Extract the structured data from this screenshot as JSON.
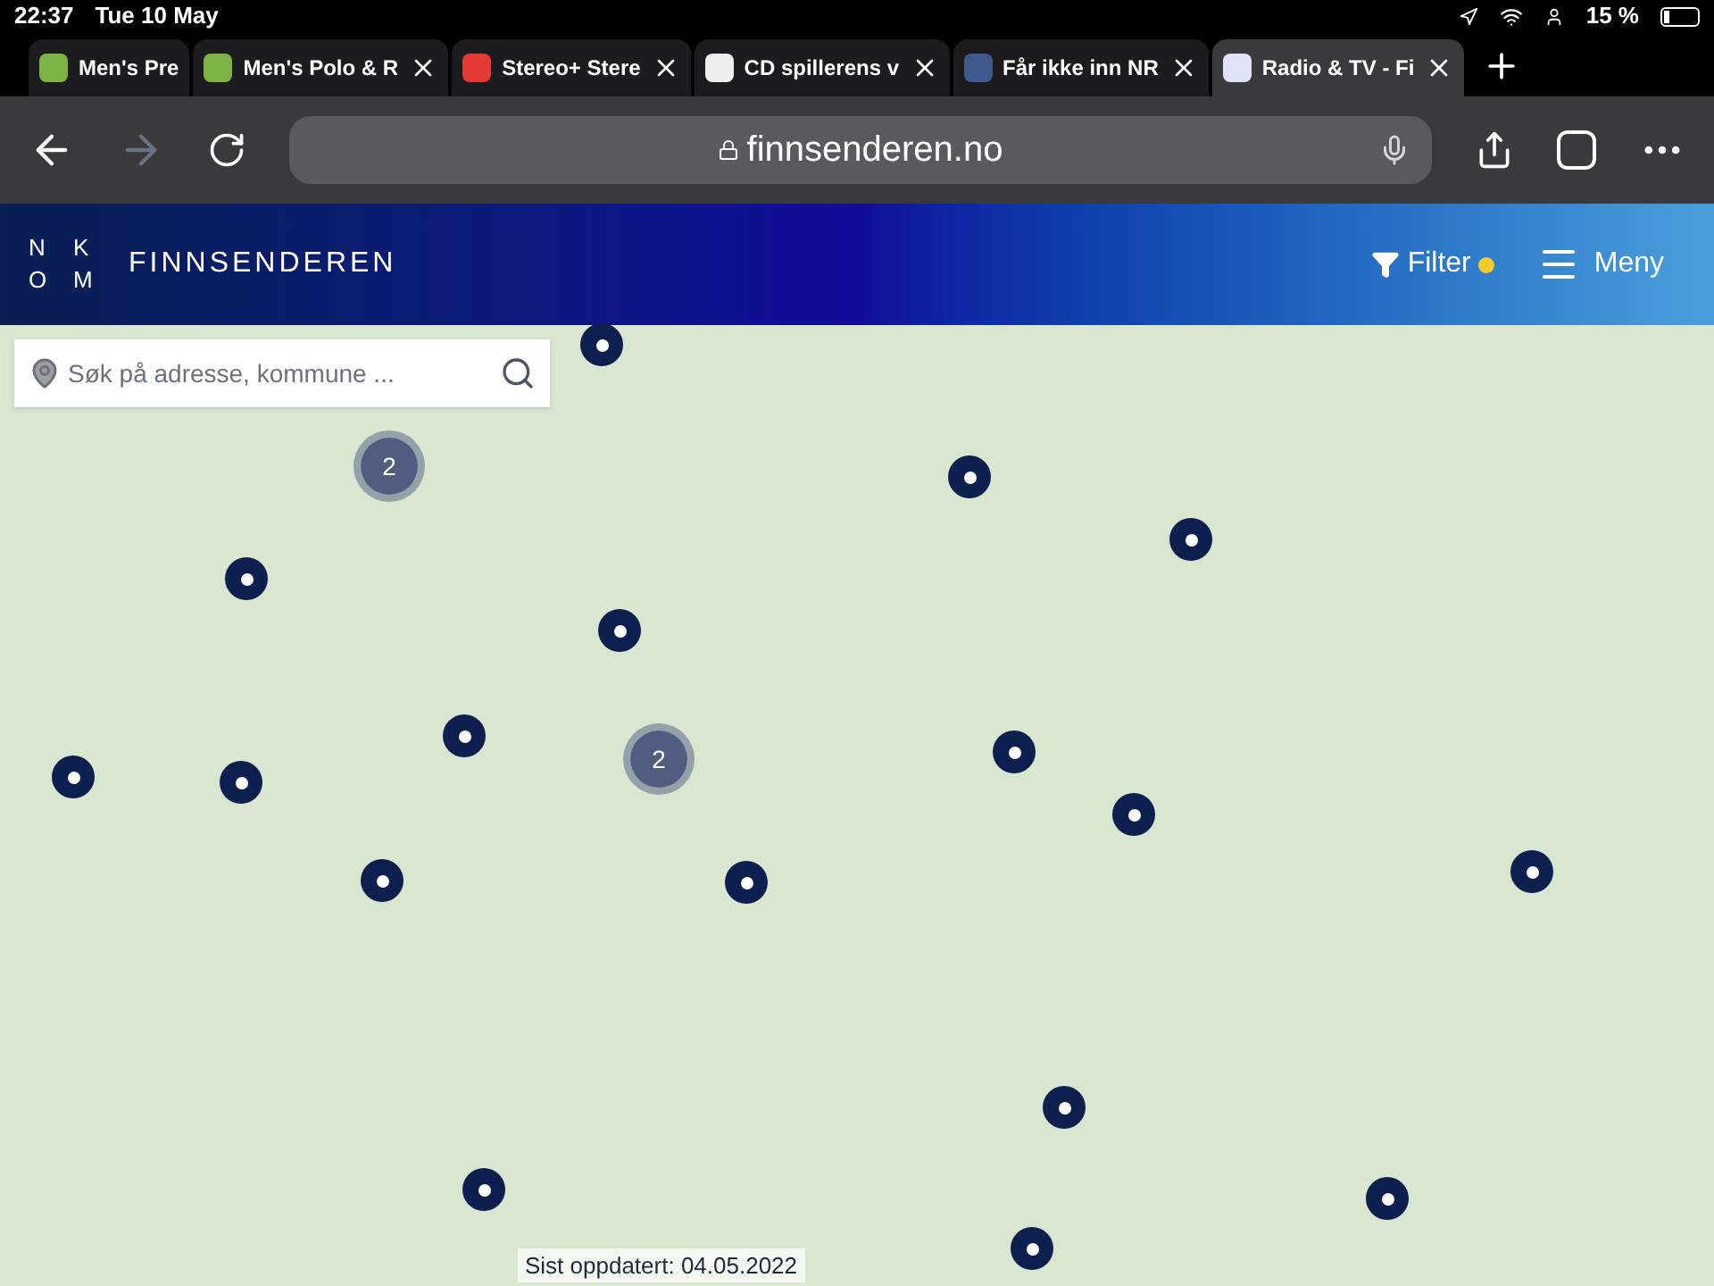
{
  "status_bar": {
    "time": "22:37",
    "date": "Tue 10 May",
    "battery": "15 %"
  },
  "tabs": [
    {
      "label": "Men's Pre",
      "selected": false
    },
    {
      "label": "Men's Polo & R",
      "selected": false
    },
    {
      "label": "Stereo+ Stere",
      "selected": false
    },
    {
      "label": "CD spillerens v",
      "selected": false
    },
    {
      "label": "Får ikke inn NR",
      "selected": false
    },
    {
      "label": "Radio & TV - Fi",
      "selected": true
    }
  ],
  "address_bar": {
    "url": "finnsenderen.no"
  },
  "header": {
    "logo_letters": [
      "N",
      "K",
      "O",
      "M"
    ],
    "title": "FINNSENDEREN",
    "filter": "Filter",
    "filter_active": true,
    "menu": "Meny"
  },
  "search": {
    "placeholder": "Søk på adresse, kommune ..."
  },
  "markers": [
    {
      "kind": "station"
    },
    {
      "kind": "station"
    },
    {
      "kind": "station"
    },
    {
      "kind": "station"
    },
    {
      "kind": "station"
    },
    {
      "kind": "station"
    },
    {
      "kind": "station"
    },
    {
      "kind": "station"
    },
    {
      "kind": "station"
    },
    {
      "kind": "station"
    },
    {
      "kind": "station"
    },
    {
      "kind": "station"
    },
    {
      "kind": "station"
    },
    {
      "kind": "station"
    },
    {
      "kind": "station"
    },
    {
      "kind": "station"
    },
    {
      "kind": "station"
    },
    {
      "kind": "cluster",
      "count": "2"
    },
    {
      "kind": "cluster",
      "count": "2"
    }
  ],
  "footer": {
    "updated": "Sist oppdatert: 04.05.2022"
  }
}
